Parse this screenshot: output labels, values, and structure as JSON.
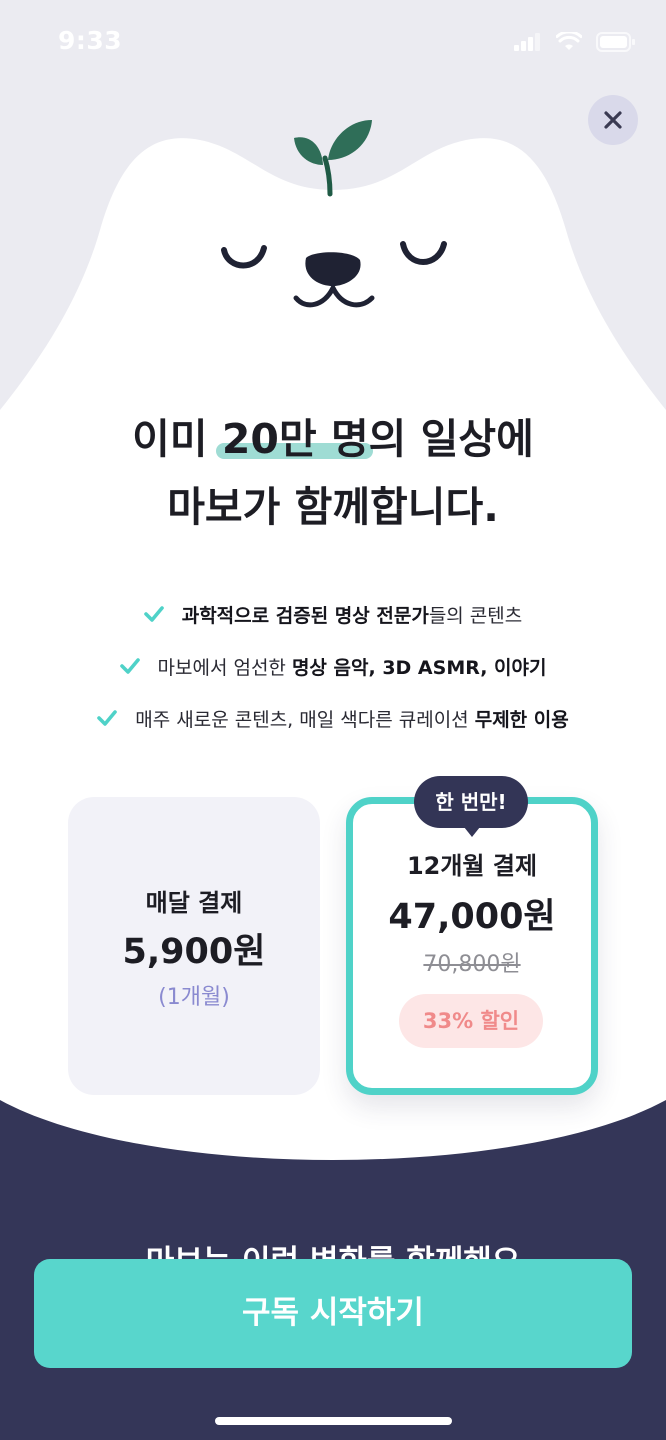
{
  "status_bar": {
    "time": "9:33"
  },
  "close_label": "✕",
  "headline": {
    "line1_before": "이미 ",
    "line1_highlight": "20만 명",
    "line1_after": "의 일상에",
    "line2": "마보가 함께합니다."
  },
  "features": [
    {
      "bold": "과학적으로 검증된 명상 전문가",
      "text": "들의 콘텐츠"
    },
    {
      "text": "마보에서 엄선한 ",
      "bold": "명상 음악, 3D ASMR, 이야기"
    },
    {
      "text": "매주 새로운 콘텐츠, 매일 색다른 큐레이션 ",
      "bold": "무제한 이용"
    }
  ],
  "plans": {
    "monthly": {
      "label": "매달 결제",
      "price": "5,900원",
      "period": "(1개월)"
    },
    "annual": {
      "badge": "한 번만!",
      "label": "12개월 결제",
      "price": "47,000원",
      "original_price": "70,800원",
      "discount": "33% 할인"
    }
  },
  "section_peek": "마보는 이런 변화를 함께해요",
  "cta": {
    "label": "구독 시작하기"
  },
  "colors": {
    "accent": "#58d6cc",
    "navy": "#333556",
    "background": "#ebebf1",
    "discount_text": "#f08a8a"
  },
  "icons": [
    "signal-icon",
    "wifi-icon",
    "battery-icon",
    "close-icon",
    "check-icon",
    "sprout-icon"
  ]
}
